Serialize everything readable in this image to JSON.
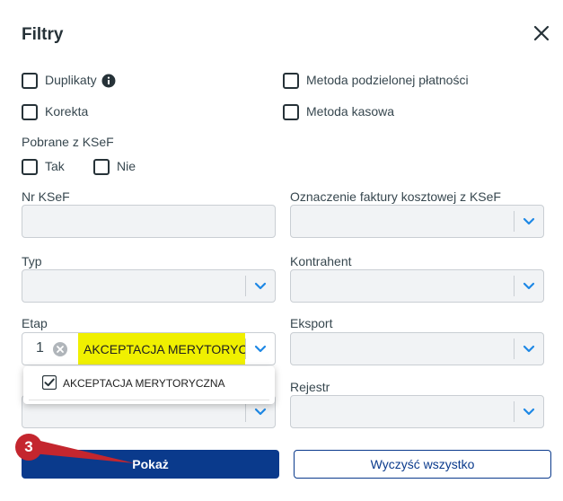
{
  "dialog": {
    "title": "Filtry",
    "close_icon": "close-icon"
  },
  "checkboxes": {
    "duplikaty": "Duplikaty",
    "metoda_podzielonej": "Metoda podzielonej płatności",
    "korekta": "Korekta",
    "metoda_kasowa": "Metoda kasowa"
  },
  "pobrane": {
    "label": "Pobrane z KSeF",
    "tak": "Tak",
    "nie": "Nie"
  },
  "fields": {
    "nr_ksef": "Nr KSeF",
    "oznaczenie": "Oznaczenie faktury kosztowej z KSeF",
    "typ": "Typ",
    "kontrahent": "Kontrahent",
    "etap": "Etap",
    "eksport": "Eksport",
    "rejestr": "Rejestr"
  },
  "etap_select": {
    "count": "1",
    "selected_value": "AKCEPTACJA MERYTORYC...",
    "highlight_color": "#f0f000"
  },
  "dropdown": {
    "option": "AKCEPTACJA MERYTORYCZNA",
    "checked": true
  },
  "buttons": {
    "pokaz": "Pokaż",
    "wyczysc": "Wyczyść wszystko"
  },
  "annotation": {
    "step": "3",
    "color": "#c4262e"
  },
  "colors": {
    "primary": "#0a3a8c",
    "chevron": "#1e88e5"
  }
}
